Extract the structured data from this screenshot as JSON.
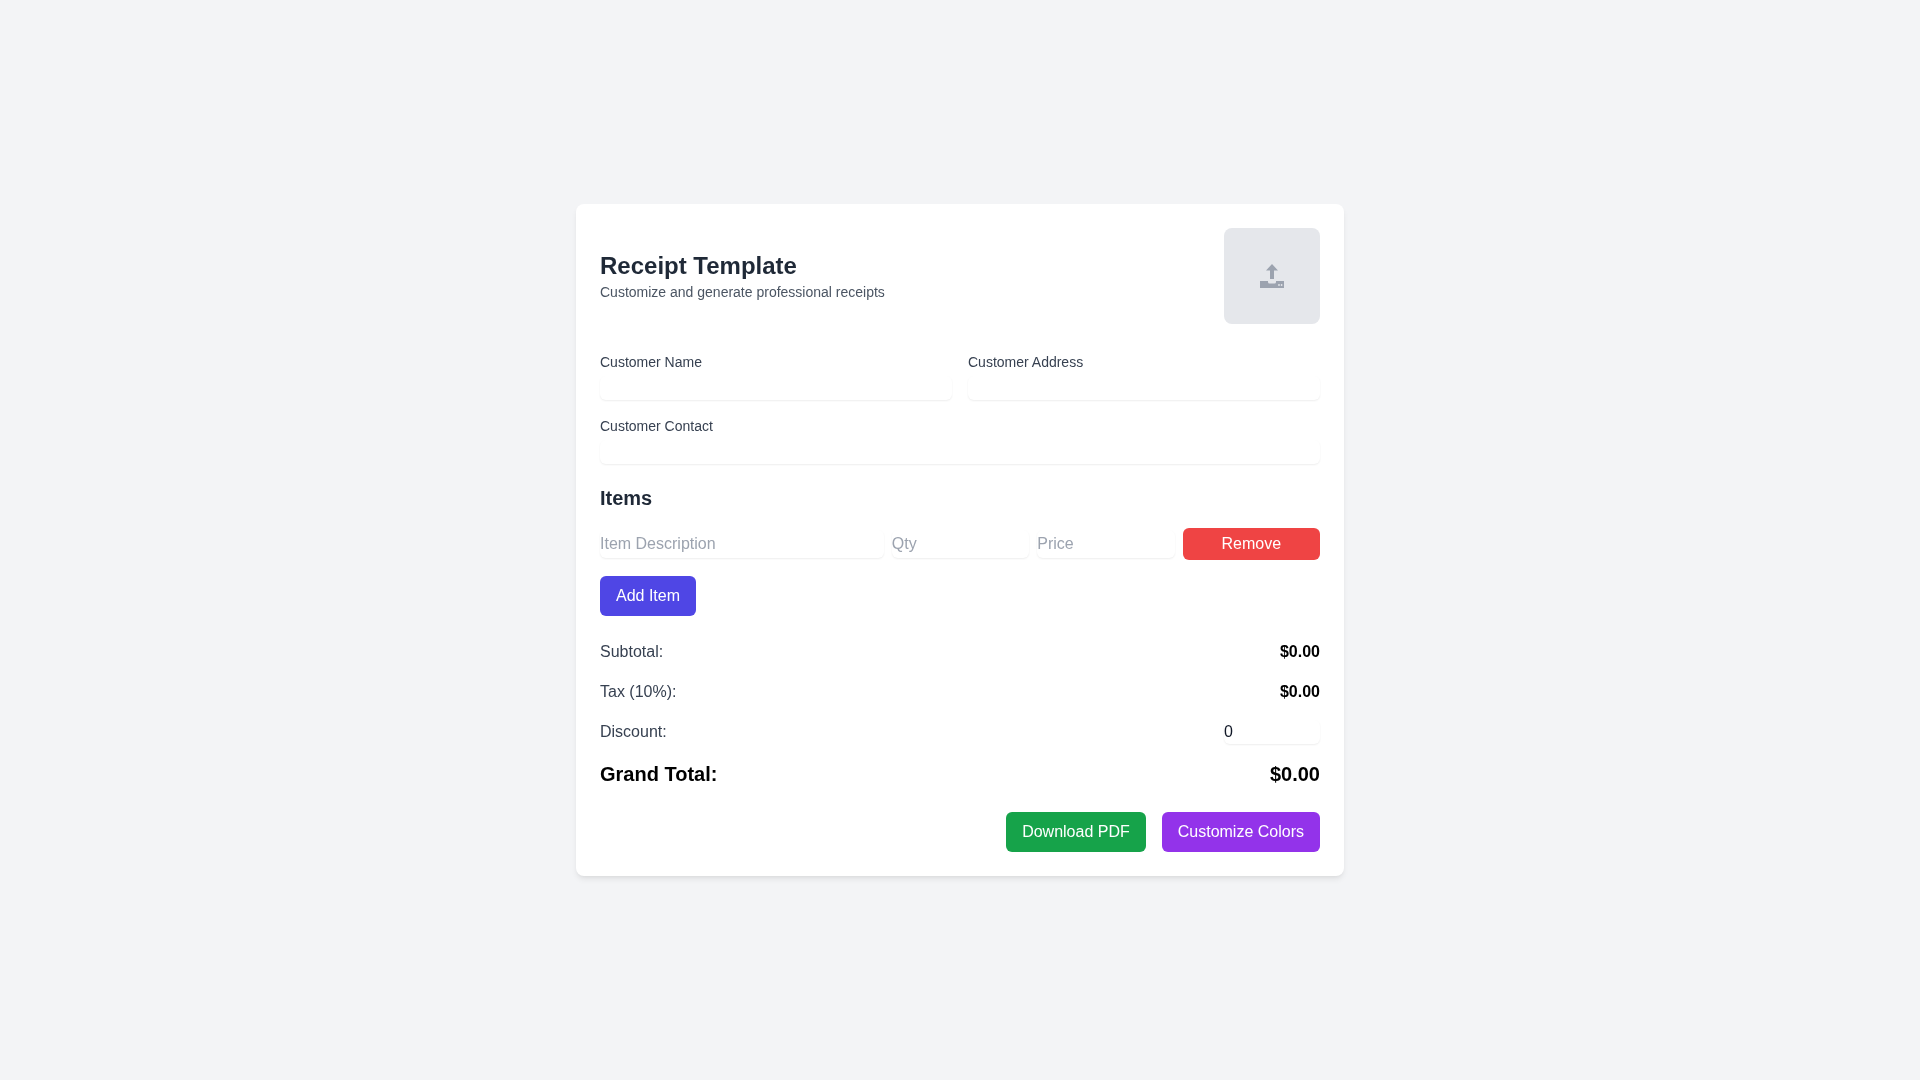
{
  "header": {
    "title": "Receipt Template",
    "subtitle": "Customize and generate professional receipts"
  },
  "customer_fields": [
    {
      "label": "Customer Name"
    },
    {
      "label": "Customer Address"
    },
    {
      "label": "Customer Contact"
    }
  ],
  "items": {
    "title": "Items",
    "rows": [
      {
        "fields": [
          {
            "placeholder": "Item Description"
          },
          {
            "placeholder": "Qty"
          },
          {
            "placeholder": "Price"
          }
        ],
        "remove_button": "Remove"
      }
    ],
    "add_button": "Add Item"
  },
  "totals": [
    {
      "kind": "amount",
      "label": "Subtotal:",
      "value": "$0.00"
    },
    {
      "kind": "amount",
      "label": "Tax (10%):",
      "value": "$0.00"
    },
    {
      "kind": "input",
      "label": "Discount:",
      "value": "0"
    },
    {
      "kind": "grand",
      "label": "Grand Total:",
      "value": "$0.00"
    }
  ],
  "actions": [
    {
      "kind": "download",
      "label": "Download PDF"
    },
    {
      "kind": "colors",
      "label": "Customize Colors"
    }
  ]
}
